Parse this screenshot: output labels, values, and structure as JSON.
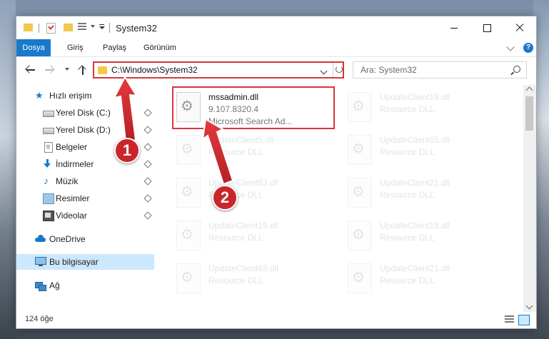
{
  "window": {
    "title": "System32"
  },
  "ribbon": {
    "tabs": [
      "Dosya",
      "Giriş",
      "Paylaş",
      "Görünüm"
    ]
  },
  "address": {
    "path": "C:\\Windows\\System32"
  },
  "search": {
    "placeholder": "Ara: System32"
  },
  "sidebar": {
    "items": [
      {
        "label": "Hızlı erişim",
        "icon": "star-icon",
        "pinned": false
      },
      {
        "label": "Yerel Disk (C:)",
        "icon": "drive-icon",
        "pinned": true
      },
      {
        "label": "Yerel Disk (D:)",
        "icon": "drive-icon",
        "pinned": true
      },
      {
        "label": "Belgeler",
        "icon": "documents-icon",
        "pinned": true
      },
      {
        "label": "İndirmeler",
        "icon": "download-icon",
        "pinned": true
      },
      {
        "label": "Müzik",
        "icon": "music-icon",
        "pinned": true
      },
      {
        "label": "Resimler",
        "icon": "pictures-icon",
        "pinned": true
      },
      {
        "label": "Videolar",
        "icon": "videos-icon",
        "pinned": true
      },
      {
        "label": "OneDrive",
        "icon": "onedrive-icon",
        "pinned": false
      },
      {
        "label": "Bu bilgisayar",
        "icon": "this-pc-icon",
        "pinned": false,
        "selected": true
      },
      {
        "label": "Ağ",
        "icon": "network-icon",
        "pinned": false
      }
    ]
  },
  "files": [
    {
      "name": "mssadmin.dll",
      "meta1": "9.107.8320.4",
      "meta2": "Microsoft Search Ad...",
      "faded": false
    },
    {
      "name": "UpdateClient19.dll",
      "meta1": "Resource DLL",
      "faded": true
    },
    {
      "name": "UpdateClient5.dll",
      "meta1": "Resource DLL",
      "faded": true
    },
    {
      "name": "UpdateClient65.dll",
      "meta1": "Resource DLL",
      "faded": true
    },
    {
      "name": "UpdateClient63.dll",
      "meta1": "Resource DLL",
      "faded": true
    },
    {
      "name": "UpdateClient21.dll",
      "meta1": "Resource DLL",
      "faded": true
    },
    {
      "name": "UpdateClient19.dll",
      "meta1": "Resource DLL",
      "faded": true
    },
    {
      "name": "UpdateClient19.dll",
      "meta1": "Resource DLL",
      "faded": true
    },
    {
      "name": "UpdateClient65.dll",
      "meta1": "Resource DLL",
      "faded": true
    },
    {
      "name": "UpdateClient21.dll",
      "meta1": "Resource DLL",
      "faded": true
    }
  ],
  "status": {
    "item_count": "124 öğe"
  },
  "annotations": {
    "step1": "1",
    "step2": "2",
    "highlight_color": "#d9353a",
    "callout_color": "#c8262b"
  },
  "colors": {
    "accent": "#1979ca",
    "selection": "#cce8ff"
  }
}
